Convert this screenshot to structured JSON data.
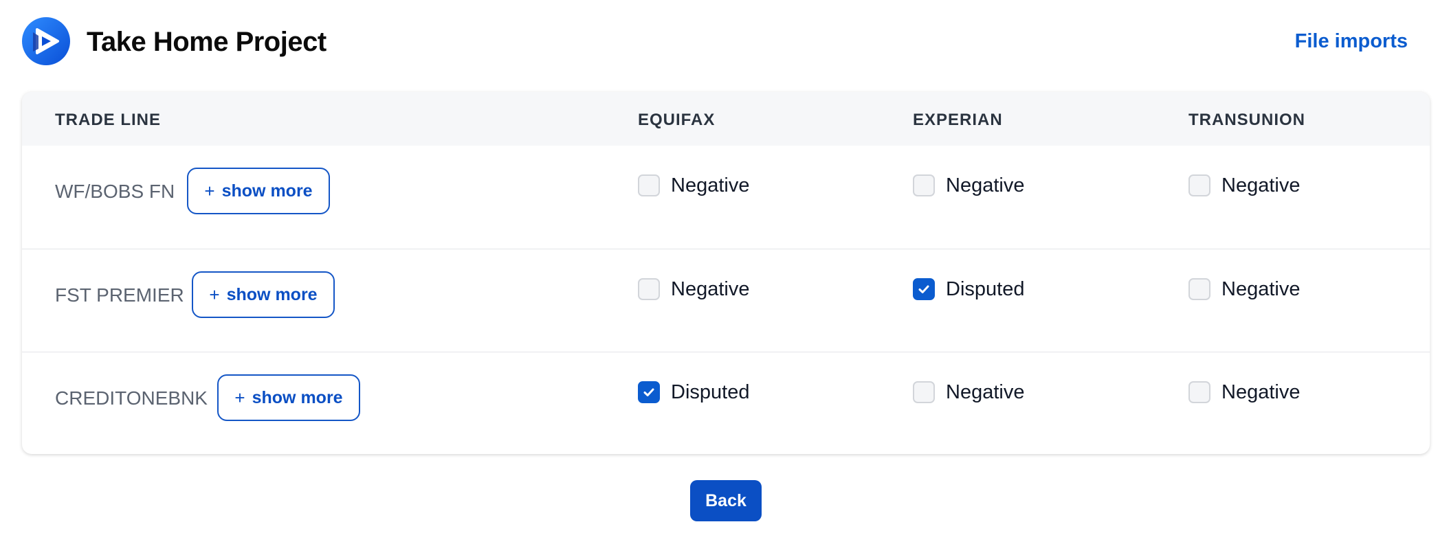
{
  "header": {
    "title": "Take Home Project",
    "nav_link": "File imports",
    "logo_icon": "play-logo-icon"
  },
  "table": {
    "columns": [
      "TRADE LINE",
      "EQUIFAX",
      "EXPERIAN",
      "TRANSUNION"
    ],
    "rows": [
      {
        "name": "WF/BOBS FN",
        "show_more": "show more",
        "bureaus": [
          {
            "checked": false,
            "label": "Negative"
          },
          {
            "checked": false,
            "label": "Negative"
          },
          {
            "checked": false,
            "label": "Negative"
          }
        ]
      },
      {
        "name": "FST PREMIER",
        "show_more": "show more",
        "bureaus": [
          {
            "checked": false,
            "label": "Negative"
          },
          {
            "checked": true,
            "label": "Disputed"
          },
          {
            "checked": false,
            "label": "Negative"
          }
        ]
      },
      {
        "name": "CREDITONEBNK",
        "show_more": "show more",
        "bureaus": [
          {
            "checked": true,
            "label": "Disputed"
          },
          {
            "checked": false,
            "label": "Negative"
          },
          {
            "checked": false,
            "label": "Negative"
          }
        ]
      }
    ]
  },
  "footer": {
    "back_label": "Back"
  },
  "colors": {
    "accent": "#0b5ccf",
    "header_bg": "#f6f7f9"
  }
}
